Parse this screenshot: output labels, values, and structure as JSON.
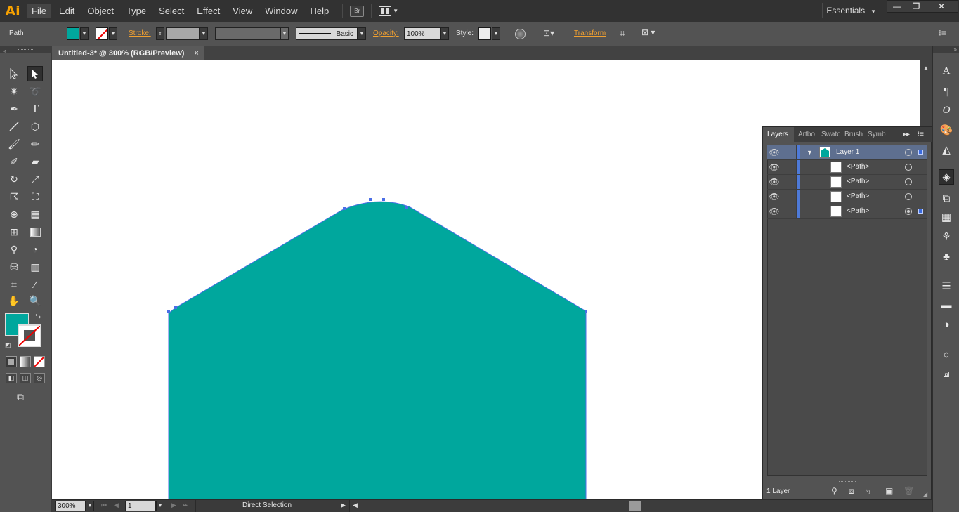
{
  "app": {
    "logo": "Ai"
  },
  "menu": [
    "File",
    "Edit",
    "Object",
    "Type",
    "Select",
    "Effect",
    "View",
    "Window",
    "Help"
  ],
  "menubar": {
    "bridge_label": "Br",
    "workspace": "Essentials"
  },
  "window_controls": [
    "—",
    "❐",
    "✕"
  ],
  "control_bar": {
    "selection_type": "Path",
    "stroke_label": "Stroke:",
    "brush_label": "Basic",
    "opacity_label": "Opacity:",
    "opacity_value": "100%",
    "style_label": "Style:",
    "transform_label": "Transform",
    "fill_color": "#00a79d"
  },
  "document": {
    "tab_title": "Untitled-3* @ 300% (RGB/Preview)",
    "close": "×"
  },
  "shape": {
    "fill": "#00a79d",
    "stroke": "#4b6ee6"
  },
  "status": {
    "zoom": "300%",
    "artboard": "1",
    "tool": "Direct Selection"
  },
  "toolbox": {
    "tools": [
      "selection-icon",
      "direct-selection-icon",
      "magic-wand-icon",
      "lasso-icon",
      "pen-icon",
      "type-icon",
      "line-icon",
      "polygon-icon",
      "paintbrush-icon",
      "pencil-icon",
      "blob-brush-icon",
      "eraser-icon",
      "rotate-icon",
      "scale-icon",
      "warp-icon",
      "free-transform-icon",
      "shape-builder-icon",
      "perspective-grid-icon",
      "mesh-icon",
      "gradient-icon",
      "eyedropper-icon",
      "blend-icon",
      "symbol-sprayer-icon",
      "column-graph-icon",
      "artboard-icon",
      "slice-icon",
      "hand-icon",
      "zoom-icon"
    ],
    "fill_color": "#00a79d"
  },
  "layers_panel": {
    "tabs": [
      "Layers",
      "Artbo",
      "Swatc",
      "Brush",
      "Symb"
    ],
    "layer_name": "Layer 1",
    "sublayers": [
      "<Path>",
      "<Path>",
      "<Path>",
      "<Path>"
    ],
    "footer_count": "1 Layer"
  }
}
